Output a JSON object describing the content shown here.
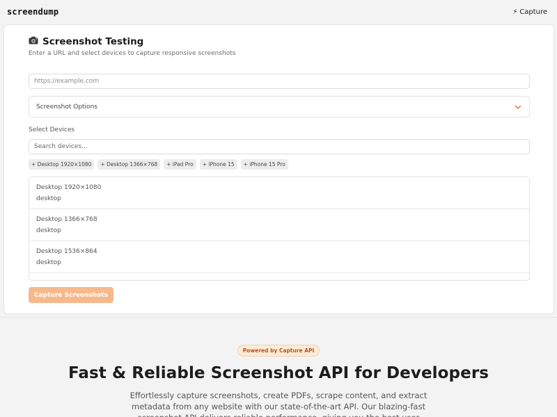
{
  "topbar": {
    "logo": "screendump",
    "capture_link": "Capture",
    "capture_icon": "lightning-icon"
  },
  "form": {
    "title": "Screenshot Testing",
    "title_icon": "camera-icon",
    "subtitle": "Enter a URL and select devices to capture responsive screenshots",
    "url_placeholder": "https://example.com",
    "options_label": "Screenshot Options",
    "select_devices_label": "Select Devices",
    "search_placeholder": "Search devices...",
    "quick_chips": [
      "+ Desktop 1920×1080",
      "+ Desktop 1366×768",
      "+ iPad Pro",
      "+ iPhone 15",
      "+ iPhone 15 Pro"
    ],
    "devices": [
      {
        "name": "Desktop 1920×1080",
        "type": "desktop"
      },
      {
        "name": "Desktop 1366×768",
        "type": "desktop"
      },
      {
        "name": "Desktop 1536×864",
        "type": "desktop"
      }
    ],
    "capture_button": "Capture Screenshots"
  },
  "hero": {
    "badge": "Powered by Capture API",
    "title": "Fast & Reliable Screenshot API for Developers",
    "description": "Effortlessly capture screenshots, create PDFs, scrape content, and extract metadata from any website with our state-of-the-art API. Our blazing-fast screenshot API delivers reliable performance, giving you the best user"
  },
  "colors": {
    "accent": "#f6b98c",
    "accent_text": "#e07a2e",
    "badge_bg": "#fdebd7",
    "badge_text": "#b4561a"
  }
}
